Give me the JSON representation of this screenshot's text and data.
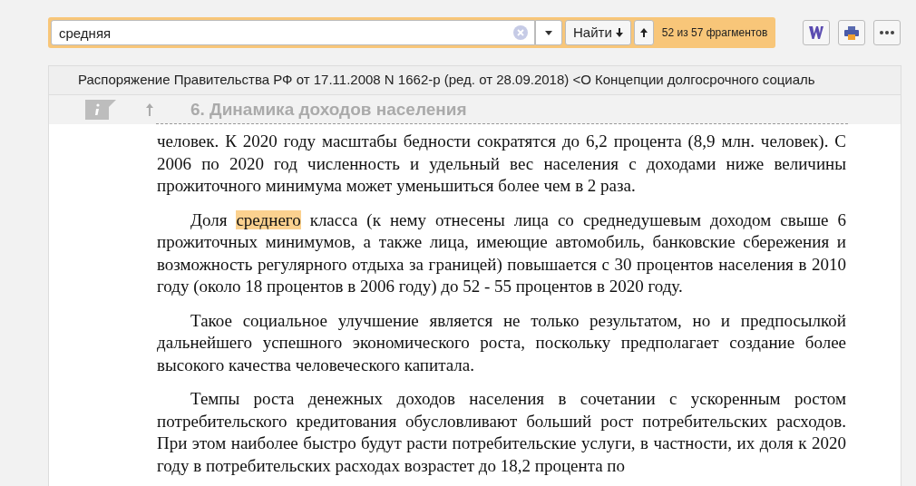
{
  "search": {
    "value": "средняя",
    "find_label": "Найти",
    "result_count": "52 из 57 фрагментов"
  },
  "document": {
    "title": "Распоряжение Правительства РФ от 17.11.2008 N 1662-р (ред. от 28.09.2018) <О Концепции долгосрочного социаль",
    "section_heading": "6. Динамика доходов населения",
    "paragraphs": [
      {
        "indent": false,
        "parts": [
          {
            "text": "человек. К 2020 году масштабы бедности сократятся до 6,2 процента (8,9 млн. человек). С 2006 по 2020 год численность и удельный вес населения с доходами ниже величины прожиточного минимума может уменьшиться более чем в 2 раза.",
            "highlighted": false
          }
        ]
      },
      {
        "indent": true,
        "parts": [
          {
            "text": "Доля ",
            "highlighted": false
          },
          {
            "text": "среднего",
            "highlighted": true
          },
          {
            "text": " класса (к нему отнесены лица со среднедушевым доходом свыше 6 прожиточных минимумов, а также лица, имеющие автомобиль, банковские сбережения и возможность регулярного отдыха за границей) повышается с 30 процентов населения в 2010 году (около 18 процентов в 2006 году) до 52 - 55 процентов в 2020 году.",
            "highlighted": false
          }
        ]
      },
      {
        "indent": true,
        "parts": [
          {
            "text": "Такое социальное улучшение является не только результатом, но и предпосылкой дальнейшего успешного экономического роста, поскольку предполагает создание более высокого качества человеческого капитала.",
            "highlighted": false
          }
        ]
      },
      {
        "indent": true,
        "parts": [
          {
            "text": "Темпы роста денежных доходов населения в сочетании с ускоренным ростом потребительского кредитования обусловливают больший рост потребительских расходов. При этом наиболее быстро будут расти потребительские услуги, в частности, их доля к 2020 году в потребительских расходах возрастет до 18,2 процента по",
            "highlighted": false
          }
        ]
      }
    ]
  }
}
